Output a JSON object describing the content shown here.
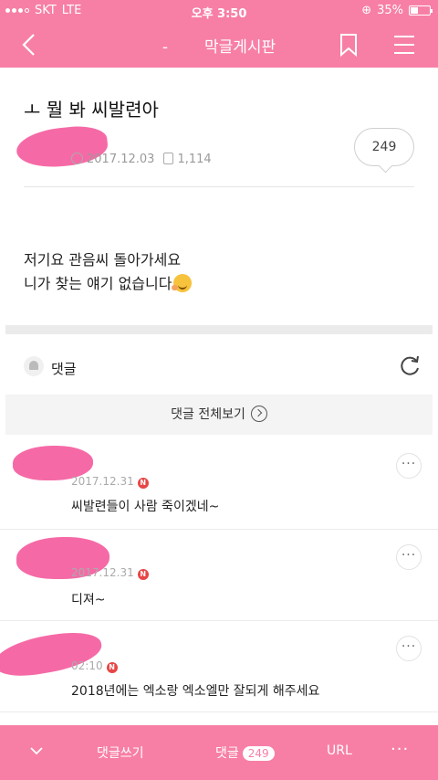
{
  "status_bar": {
    "carrier": "SKT",
    "network": "LTE",
    "time": "오후 3:50",
    "battery": "35%"
  },
  "app_bar": {
    "dash": "-",
    "title": "막글게시판"
  },
  "post": {
    "title": "ㅗ 뭘 봐 씨발련아",
    "date": "2017.12.03",
    "views": "1,114",
    "comment_count": "249",
    "body_line1": "저기요 관음씨 돌아가세요",
    "body_line2": "니가 찾는 얘기 없습니다"
  },
  "comments_section": {
    "header_label": "댓글",
    "view_all_label": "댓글 전체보기",
    "items": [
      {
        "time": "2017.12.31",
        "badge": "N",
        "text": "씨발련들이 사람 죽이겠네~"
      },
      {
        "time": "2017.12.31",
        "badge": "N",
        "text": "디져~"
      },
      {
        "time": "02:10",
        "badge": "N",
        "text": "2018년에는 엑소랑 엑소엘만 잘되게 해주세요"
      }
    ],
    "more_label": "···"
  },
  "bottom_bar": {
    "write_label": "댓글쓰기",
    "comments_label": "댓글",
    "comments_count": "249",
    "url_label": "URL",
    "more_label": "···"
  },
  "colors": {
    "brand_pink": "#f77fa6",
    "redaction_pink": "#f56aa6"
  },
  "icons": [
    "back-icon",
    "bookmark-icon",
    "menu-icon",
    "clock-icon",
    "document-icon",
    "bell-icon",
    "refresh-icon",
    "chevron-right-icon",
    "chevron-down-icon",
    "more-icon"
  ]
}
